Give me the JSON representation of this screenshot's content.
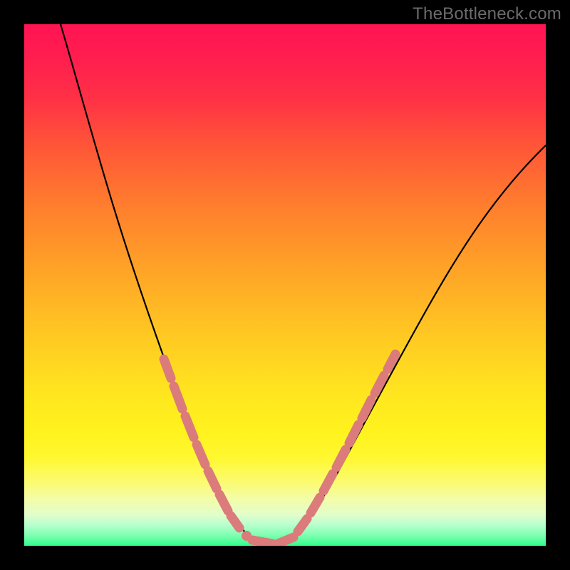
{
  "watermark": "TheBottleneck.com",
  "colors": {
    "background": "#000000",
    "gradient_top": "#ff1452",
    "gradient_mid": "#ffe81f",
    "gradient_bottom": "#2dff8e",
    "curve": "#000000",
    "beads": "#db7b7b"
  },
  "chart_data": {
    "type": "line",
    "title": "",
    "xlabel": "",
    "ylabel": "",
    "xlim": [
      0,
      100
    ],
    "ylim": [
      0,
      100
    ],
    "note": "No axis ticks or labels are rendered; values are normalized 0-100 on each axis, y increases downward in image space.",
    "series": [
      {
        "name": "curve",
        "x": [
          7,
          9,
          12,
          15,
          17.5,
          20,
          22,
          24,
          26,
          27.5,
          29,
          30.5,
          32,
          33.3,
          34.5,
          35.7,
          37,
          38.3,
          39.7,
          41.2,
          42.8,
          44.5,
          46.5,
          49,
          52,
          55,
          58,
          61,
          64,
          67,
          70,
          73,
          76,
          79,
          82,
          85,
          88,
          91,
          94,
          97,
          100
        ],
        "y": [
          0,
          8,
          18,
          29,
          37,
          45,
          51,
          57,
          63,
          67.5,
          71.5,
          75,
          78.5,
          81.5,
          84.3,
          86.8,
          89,
          91,
          93,
          94.8,
          96.3,
          97.5,
          98.5,
          99.3,
          99.3,
          98.5,
          96.8,
          94.2,
          90.8,
          86.8,
          82.2,
          77.2,
          72,
          66.4,
          60.6,
          54.6,
          48.5,
          42.3,
          36,
          29.5,
          23
        ]
      }
    ],
    "beads": {
      "description": "Highlighted pink segments near the valley of the curve",
      "left_branch_x_range": [
        27,
        38
      ],
      "right_branch_x_range": [
        46,
        58
      ],
      "flat_bottom_x_range": [
        38,
        46
      ]
    }
  }
}
